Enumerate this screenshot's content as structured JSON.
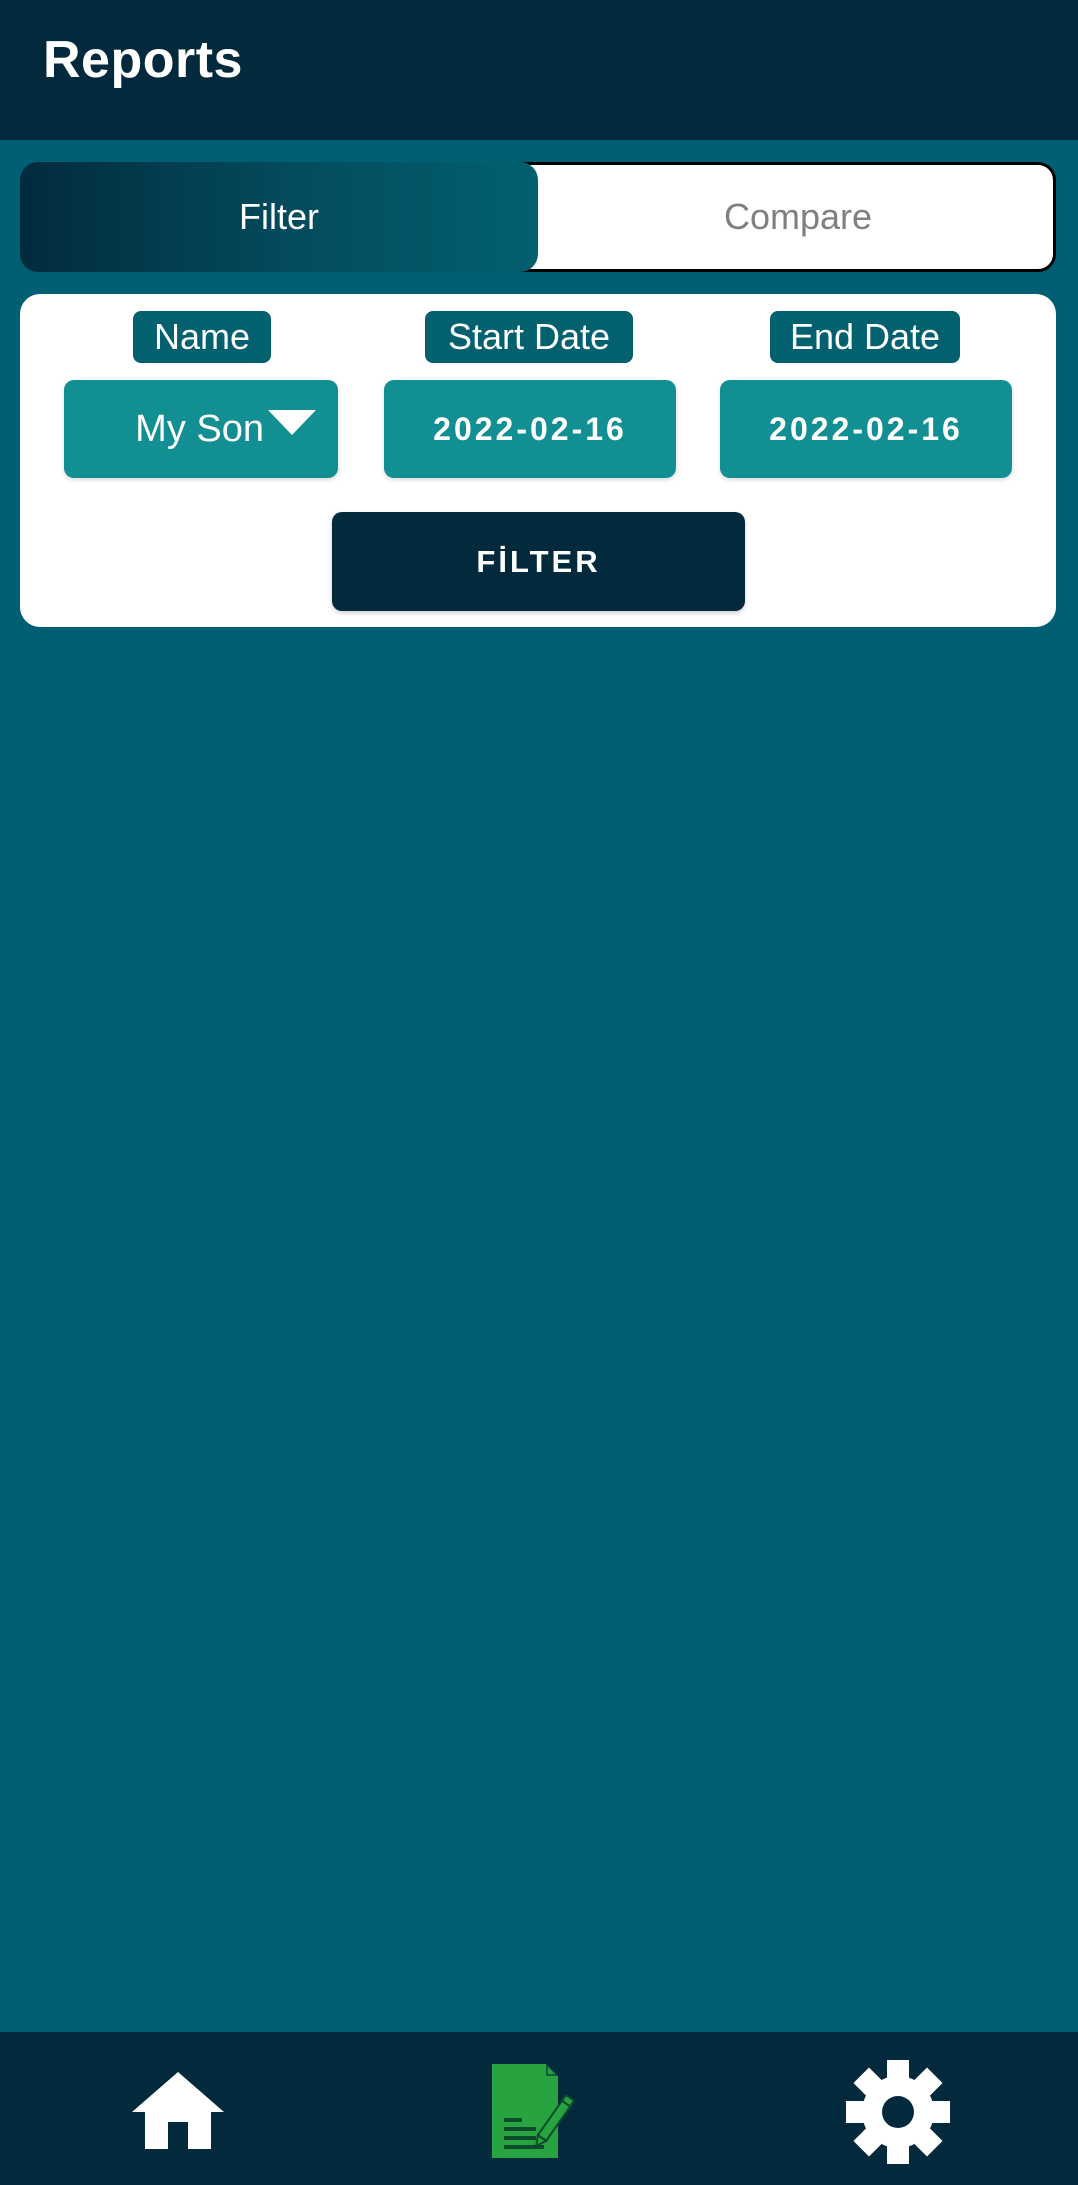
{
  "header": {
    "title": "Reports"
  },
  "tabs": [
    {
      "label": "Filter",
      "active": true
    },
    {
      "label": "Compare",
      "active": false
    }
  ],
  "filter_form": {
    "name_label": "Name",
    "name_value": "My Son",
    "start_date_label": "Start Date",
    "start_date_value": "2022-02-16",
    "end_date_label": "End Date",
    "end_date_value": "2022-02-16",
    "submit_label": "FİLTER"
  },
  "bottom_nav": {
    "items": [
      {
        "icon": "home-icon",
        "active": false
      },
      {
        "icon": "report-edit-icon",
        "active": true
      },
      {
        "icon": "gear-icon",
        "active": false
      }
    ]
  },
  "colors": {
    "header_bg": "#022a3c",
    "page_bg": "#005f73",
    "field_bg": "#118f93",
    "label_bg": "#02606f",
    "active_nav_icon": "#27a33f",
    "nav_icon": "#ffffff"
  }
}
